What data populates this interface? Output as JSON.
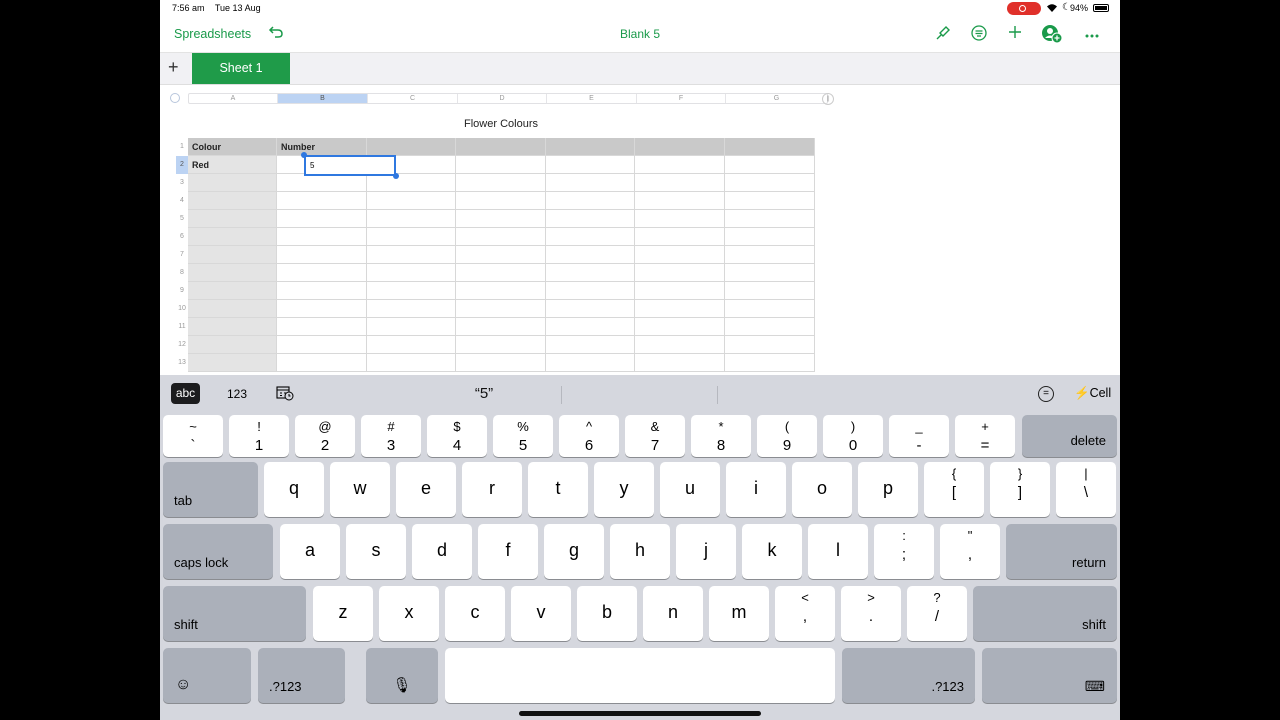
{
  "status": {
    "time": "7:56 am",
    "date": "Tue 13 Aug",
    "battery": "94%"
  },
  "toolbar": {
    "back_label": "Spreadsheets",
    "doc_title": "Blank 5"
  },
  "tabs": {
    "sheet_label": "Sheet 1"
  },
  "columns": [
    "A",
    "B",
    "C",
    "D",
    "E",
    "F",
    "G"
  ],
  "rows": [
    "1",
    "2",
    "3",
    "4",
    "5",
    "6",
    "7",
    "8",
    "9",
    "10",
    "11",
    "12",
    "13"
  ],
  "table": {
    "title": "Flower Colours",
    "header": [
      "Colour",
      "Number"
    ],
    "row2": [
      "Red"
    ],
    "active_value": "5"
  },
  "keyboard": {
    "shortcuts": {
      "abc": "abc",
      "num": "123",
      "prediction": "“5”",
      "cell": "Cell"
    },
    "number_row": [
      {
        "t": "~",
        "b": "`"
      },
      {
        "t": "!",
        "b": "1"
      },
      {
        "t": "@",
        "b": "2"
      },
      {
        "t": "#",
        "b": "3"
      },
      {
        "t": "$",
        "b": "4"
      },
      {
        "t": "%",
        "b": "5"
      },
      {
        "t": "^",
        "b": "6"
      },
      {
        "t": "&",
        "b": "7"
      },
      {
        "t": "*",
        "b": "8"
      },
      {
        "t": "(",
        "b": "9"
      },
      {
        "t": ")",
        "b": "0"
      },
      {
        "t": "_",
        "b": "-"
      },
      {
        "t": "+",
        "b": "="
      }
    ],
    "delete": "delete",
    "tab": "tab",
    "row_q": [
      "q",
      "w",
      "e",
      "r",
      "t",
      "y",
      "u",
      "i",
      "o",
      "p"
    ],
    "row_q_extra": [
      {
        "t": "{",
        "b": "["
      },
      {
        "t": "}",
        "b": "]"
      },
      {
        "t": "|",
        "b": "\\"
      }
    ],
    "caps": "caps lock",
    "row_a": [
      "a",
      "s",
      "d",
      "f",
      "g",
      "h",
      "j",
      "k",
      "l"
    ],
    "row_a_extra": [
      {
        "t": ":",
        "b": ";"
      },
      {
        "t": "\"",
        "b": ","
      }
    ],
    "return": "return",
    "shift": "shift",
    "row_z": [
      "z",
      "x",
      "c",
      "v",
      "b",
      "n",
      "m"
    ],
    "row_z_extra": [
      {
        "t": "<",
        "b": ","
      },
      {
        "t": ">",
        "b": "."
      },
      {
        "t": "?",
        "b": "/"
      }
    ],
    "num_switch": ".?123"
  }
}
